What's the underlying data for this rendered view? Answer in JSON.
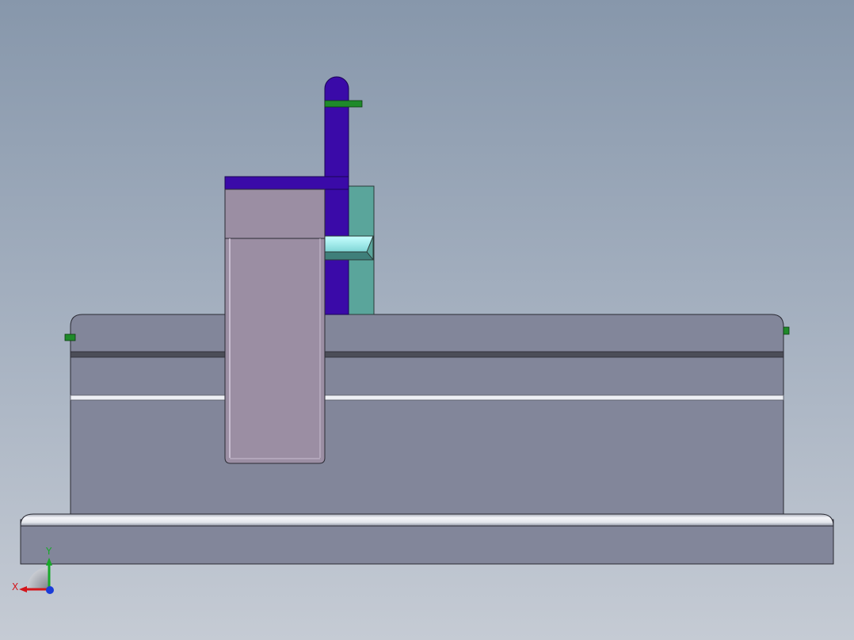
{
  "viewport": {
    "colors": {
      "background_top": "#8797ab",
      "background_bottom": "#c5cbd4",
      "body_gray": "#82869a",
      "base_edge_highlight": "#f2f3f7",
      "column_mauve": "#9b8ea3",
      "rod_purple": "#3a0aa8",
      "slider_teal": "#5aa59b",
      "wedge_cyan": "#a8f2f2",
      "marker_green": "#1f8a2a",
      "outline": "#2a2a33"
    }
  },
  "triad": {
    "x_label": "X",
    "y_label": "Y",
    "x_color": "#d4151b",
    "y_color": "#18a82a",
    "z_color": "#1a3cd8"
  }
}
